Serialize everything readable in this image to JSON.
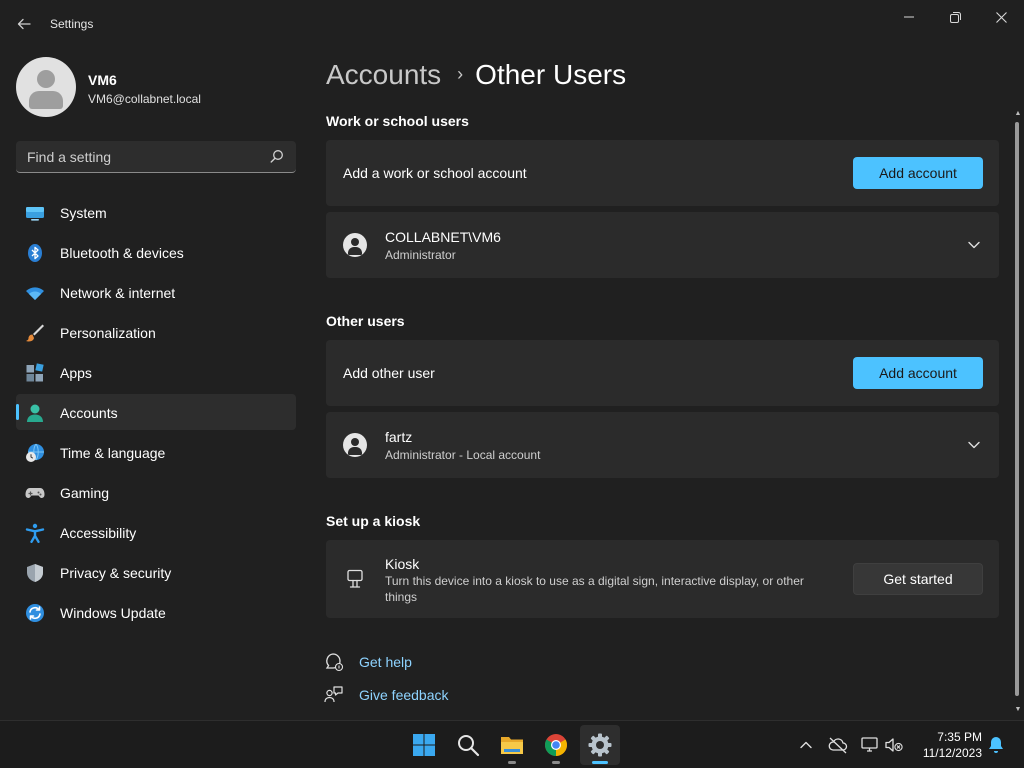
{
  "window": {
    "title": "Settings"
  },
  "profile": {
    "name": "VM6",
    "email": "VM6@collabnet.local"
  },
  "search": {
    "placeholder": "Find a setting"
  },
  "sidebar": {
    "items": [
      {
        "label": "System",
        "icon": "monitor-icon"
      },
      {
        "label": "Bluetooth & devices",
        "icon": "bluetooth-icon"
      },
      {
        "label": "Network & internet",
        "icon": "wifi-icon"
      },
      {
        "label": "Personalization",
        "icon": "brush-icon"
      },
      {
        "label": "Apps",
        "icon": "apps-icon"
      },
      {
        "label": "Accounts",
        "icon": "person-icon",
        "active": true
      },
      {
        "label": "Time & language",
        "icon": "globe-clock-icon"
      },
      {
        "label": "Gaming",
        "icon": "gamepad-icon"
      },
      {
        "label": "Accessibility",
        "icon": "accessibility-icon"
      },
      {
        "label": "Privacy & security",
        "icon": "shield-icon"
      },
      {
        "label": "Windows Update",
        "icon": "update-icon"
      }
    ]
  },
  "breadcrumb": {
    "parent": "Accounts",
    "separator": "›",
    "current": "Other Users"
  },
  "work_school": {
    "title": "Work or school users",
    "add_text": "Add a work or school account",
    "add_button": "Add account",
    "user": {
      "name": "COLLABNET\\VM6",
      "role": "Administrator"
    }
  },
  "other_users": {
    "title": "Other users",
    "add_text": "Add other user",
    "add_button": "Add account",
    "user": {
      "name": "fartz",
      "role": "Administrator - Local account"
    }
  },
  "kiosk": {
    "title": "Set up a kiosk",
    "name": "Kiosk",
    "description_line1": "Turn this device into a kiosk to use as a digital sign, interactive display, or other",
    "description_line2": "things",
    "button": "Get started"
  },
  "links": {
    "help": "Get help",
    "feedback": "Give feedback"
  },
  "taskbar": {
    "time": "7:35 PM",
    "date": "11/12/2023"
  },
  "colors": {
    "accent": "#4cc2ff",
    "background": "#202020",
    "card": "#2b2b2b"
  }
}
